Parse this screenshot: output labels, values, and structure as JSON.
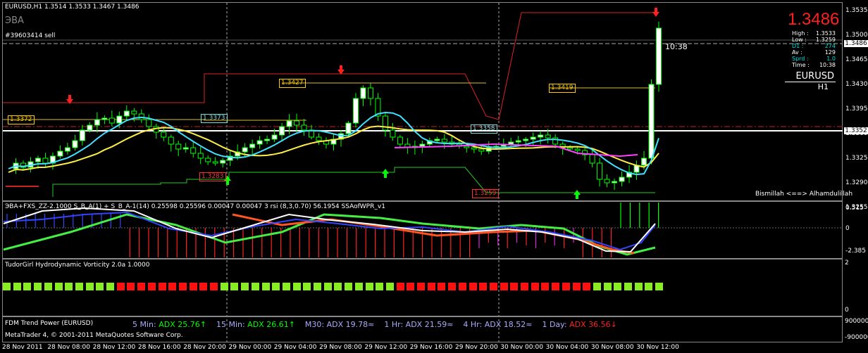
{
  "symbol_header": "EURUSD,H1  1.3514 1.3533 1.3467 1.3486",
  "eba_label": "ЭВА",
  "order_label": "#39603414 sell",
  "big_price": "1.3486",
  "info_box": {
    "rows": [
      {
        "label": "High :",
        "value": "1.3533",
        "color": "#ffffff"
      },
      {
        "label": "Low :",
        "value": "1.3259",
        "color": "#ffffff"
      },
      {
        "label": "D1 :",
        "value": "274",
        "color": "#00e0e0"
      },
      {
        "label": "Av :",
        "value": "129",
        "color": "#ffffff"
      },
      {
        "label": "Sprd :",
        "value": "1.0",
        "color": "#00e0e0"
      },
      {
        "label": "Time :",
        "value": "10:38",
        "color": "#ffffff"
      }
    ],
    "pair": "EURUSD",
    "tf": "H1"
  },
  "time_label": "10:38",
  "price_axis": [
    "1.3535",
    "1.3500",
    "1.3465",
    "1.3430",
    "1.3395",
    "1.3360",
    "1.3325",
    "1.3290",
    "1.3255"
  ],
  "price_tag_current": "1.3486",
  "price_tag_line": "1.3352",
  "level_labels": [
    {
      "text": "1.3372",
      "color": "#ffcc00"
    },
    {
      "text": "1.3427",
      "color": "#ffcc00"
    },
    {
      "text": "1.3419",
      "color": "#ffcc00"
    },
    {
      "text": "1.3373",
      "color": "#7fdcdc"
    },
    {
      "text": "1.3358",
      "color": "#7fdcdc"
    },
    {
      "text": "1.3283",
      "color": "#ff3030"
    },
    {
      "text": "1.3259",
      "color": "#ff3030"
    }
  ],
  "bismillah": "Bismillah <==> Alhamdulillah",
  "indicator1_title": "ЭВА+FXS_ZZ-2.1000  S_B_A(1) + S_B_A-1(14) 0.25598 0.25596 0.00047 0.00047  3 rsi (8,3,0.70) 56.1954  SSAofWPR_v1",
  "ind1_axis": [
    "0.515",
    "0",
    "-2.385"
  ],
  "indicator2_title": "TudorGirl Hydrodynamic Vorticity 2.0a 1.0000",
  "ind2_axis": [
    "2",
    "0"
  ],
  "vorticity_blocks": [
    "g",
    "g",
    "g",
    "g",
    "g",
    "g",
    "g",
    "g",
    "g",
    "g",
    "g",
    "r",
    "r",
    "r",
    "r",
    "r",
    "r",
    "r",
    "r",
    "r",
    "r",
    "g",
    "g",
    "g",
    "g",
    "g",
    "g",
    "g",
    "g",
    "g",
    "g",
    "g",
    "g",
    "g",
    "g",
    "g",
    "g",
    "g",
    "r",
    "r",
    "r",
    "r",
    "r",
    "r",
    "r",
    "r",
    "r",
    "r",
    "r",
    "r",
    "r",
    "r",
    "r",
    "r",
    "r",
    "r",
    "r",
    "g",
    "g",
    "g",
    "g",
    "g",
    "g",
    "g"
  ],
  "indicator3_title": "FDM Trend Power (EURUSD)",
  "adx_items": [
    {
      "tf": "5 Min:",
      "adx": "ADX 25.76",
      "color": "#00ff00",
      "arrow": "up"
    },
    {
      "tf": "15 Min:",
      "adx": "ADX 26.61",
      "color": "#00ff00",
      "arrow": "up"
    },
    {
      "tf": "M30:",
      "adx": "ADX 19.78",
      "color": "#aaaaff",
      "arrow": "wave"
    },
    {
      "tf": "1 Hr:",
      "adx": "ADX 21.59",
      "color": "#aaaaff",
      "arrow": "wave"
    },
    {
      "tf": "4 Hr:",
      "adx": "ADX 18.52",
      "color": "#aaaaff",
      "arrow": "wave"
    },
    {
      "tf": "1 Day:",
      "adx": "ADX 36.56",
      "color": "#ff2020",
      "arrow": "down"
    }
  ],
  "copyright": "MetaTrader 4, © 2001-2011 MetaQuotes Software Corp.",
  "ind3_axis": [
    "9000000",
    "-9000000"
  ],
  "time_axis": [
    "28 Nov 2011",
    "28 Nov 08:00",
    "28 Nov 12:00",
    "28 Nov 16:00",
    "28 Nov 20:00",
    "29 Nov 00:00",
    "29 Nov 04:00",
    "29 Nov 08:00",
    "29 Nov 12:00",
    "29 Nov 16:00",
    "29 Nov 20:00",
    "30 Nov 00:00",
    "30 Nov 04:00",
    "30 Nov 08:00",
    "30 Nov 12:00"
  ],
  "colors": {
    "bull": "#ffffff",
    "bear": "#00ff00",
    "up_arrow": "#00ff00",
    "down_arrow": "#ff2020",
    "cyan_ma": "#40e0ff",
    "yellow_ma": "#ffee44",
    "magenta_line": "#ff40ff",
    "red_channel": "#dd2222",
    "green_channel": "#22cc22"
  }
}
